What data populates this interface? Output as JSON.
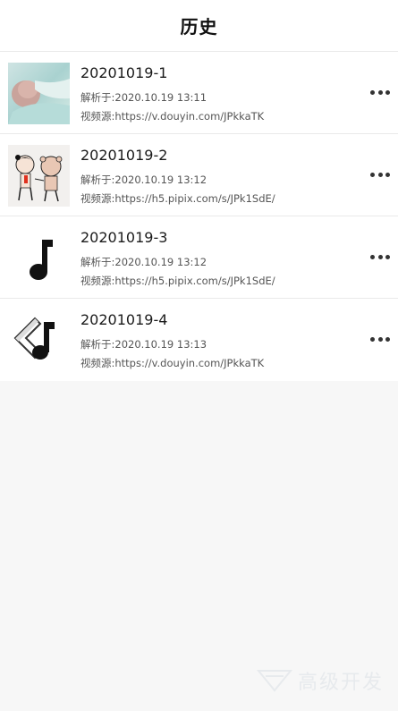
{
  "header": {
    "title": "历史"
  },
  "items": [
    {
      "name": "20201019-1",
      "parsed": "解析于:2020.10.19 13:11",
      "source": "视频源:https://v.douyin.com/JPkkaTK",
      "thumb": "baby-photo"
    },
    {
      "name": "20201019-2",
      "parsed": "解析于:2020.10.19 13:12",
      "source": "视频源:https://h5.pipix.com/s/JPk1SdE/",
      "thumb": "cartoon-figures"
    },
    {
      "name": "20201019-3",
      "parsed": "解析于:2020.10.19 13:12",
      "source": "视频源:https://h5.pipix.com/s/JPk1SdE/",
      "thumb": "music-note-icon"
    },
    {
      "name": "20201019-4",
      "parsed": "解析于:2020.10.19 13:13",
      "source": "视频源:https://v.douyin.com/JPkkaTK",
      "thumb": "tiktok-logo-icon"
    }
  ],
  "watermark": {
    "text": "高级开发"
  },
  "colors": {
    "background": "#f7f7f7",
    "card": "#ffffff",
    "text_primary": "#1a1a1a",
    "text_secondary": "#555555"
  }
}
